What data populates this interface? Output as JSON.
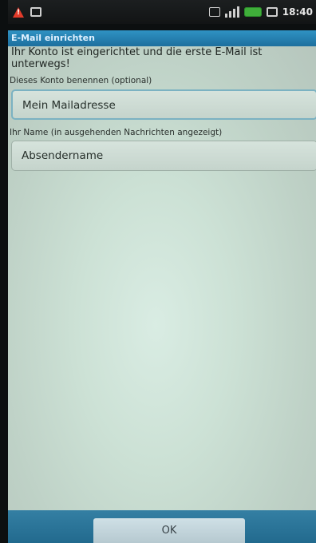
{
  "status_bar": {
    "time": "18:40",
    "icons": [
      "warning-icon",
      "notification-icon",
      "data-icon",
      "signal-icon",
      "battery-icon",
      "sync-icon"
    ]
  },
  "title_bar": {
    "title": "E-Mail einrichten"
  },
  "main": {
    "message": "Ihr Konto ist eingerichtet und die erste E-Mail ist unterwegs!",
    "account_name": {
      "label": "Dieses Konto benennen (optional)",
      "value": "Mein Mailadresse"
    },
    "your_name": {
      "label": "Ihr Name (in ausgehenden Nachrichten angezeigt)",
      "value": "Absendername"
    }
  },
  "bottom_bar": {
    "ok_label": "OK"
  },
  "colors": {
    "title_bar": "#2a86b8",
    "bottom_bar": "#2b7499",
    "warning": "#e33b2a",
    "battery": "#3fae3a"
  }
}
